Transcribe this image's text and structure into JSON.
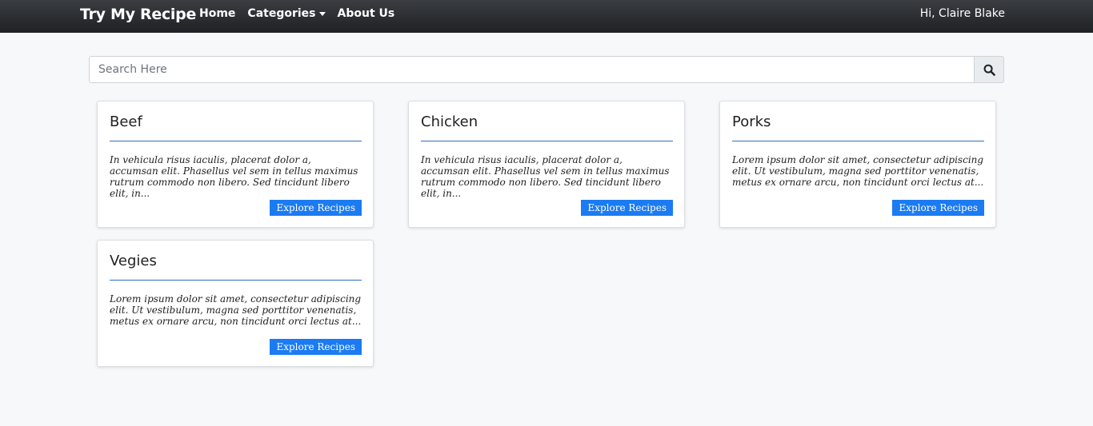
{
  "nav": {
    "brand": "Try My Recipe",
    "links": [
      {
        "label": "Home"
      },
      {
        "label": "Categories"
      },
      {
        "label": "About Us"
      }
    ],
    "user_greeting": "Hi, Claire Blake"
  },
  "search": {
    "placeholder": "Search Here",
    "value": "",
    "icon": "search-icon"
  },
  "cards": [
    {
      "title": "Beef",
      "text": "In vehicula risus iaculis, placerat dolor a, accumsan elit. Phasellus vel sem in tellus maximus rutrum commodo non libero. Sed tincidunt libero elit, in...",
      "button": "Explore Recipes"
    },
    {
      "title": "Chicken",
      "text": "In vehicula risus iaculis, placerat dolor a, accumsan elit. Phasellus vel sem in tellus maximus rutrum commodo non libero. Sed tincidunt libero elit, in...",
      "button": "Explore Recipes"
    },
    {
      "title": "Porks",
      "text": "Lorem ipsum dolor sit amet, consectetur adipiscing elit. Ut vestibulum, magna sed porttitor venenatis, metus ex ornare arcu, non tincidunt orci lectus at...",
      "button": "Explore Recipes"
    },
    {
      "title": "Vegies",
      "text": "Lorem ipsum dolor sit amet, consectetur adipiscing elit. Ut vestibulum, magna sed porttitor venenatis, metus ex ornare arcu, non tincidunt orci lectus at...",
      "button": "Explore Recipes"
    }
  ],
  "colors": {
    "accent": "#1b7bf2",
    "navbar": "#2a2c30",
    "rule": "#2c6fc5"
  }
}
